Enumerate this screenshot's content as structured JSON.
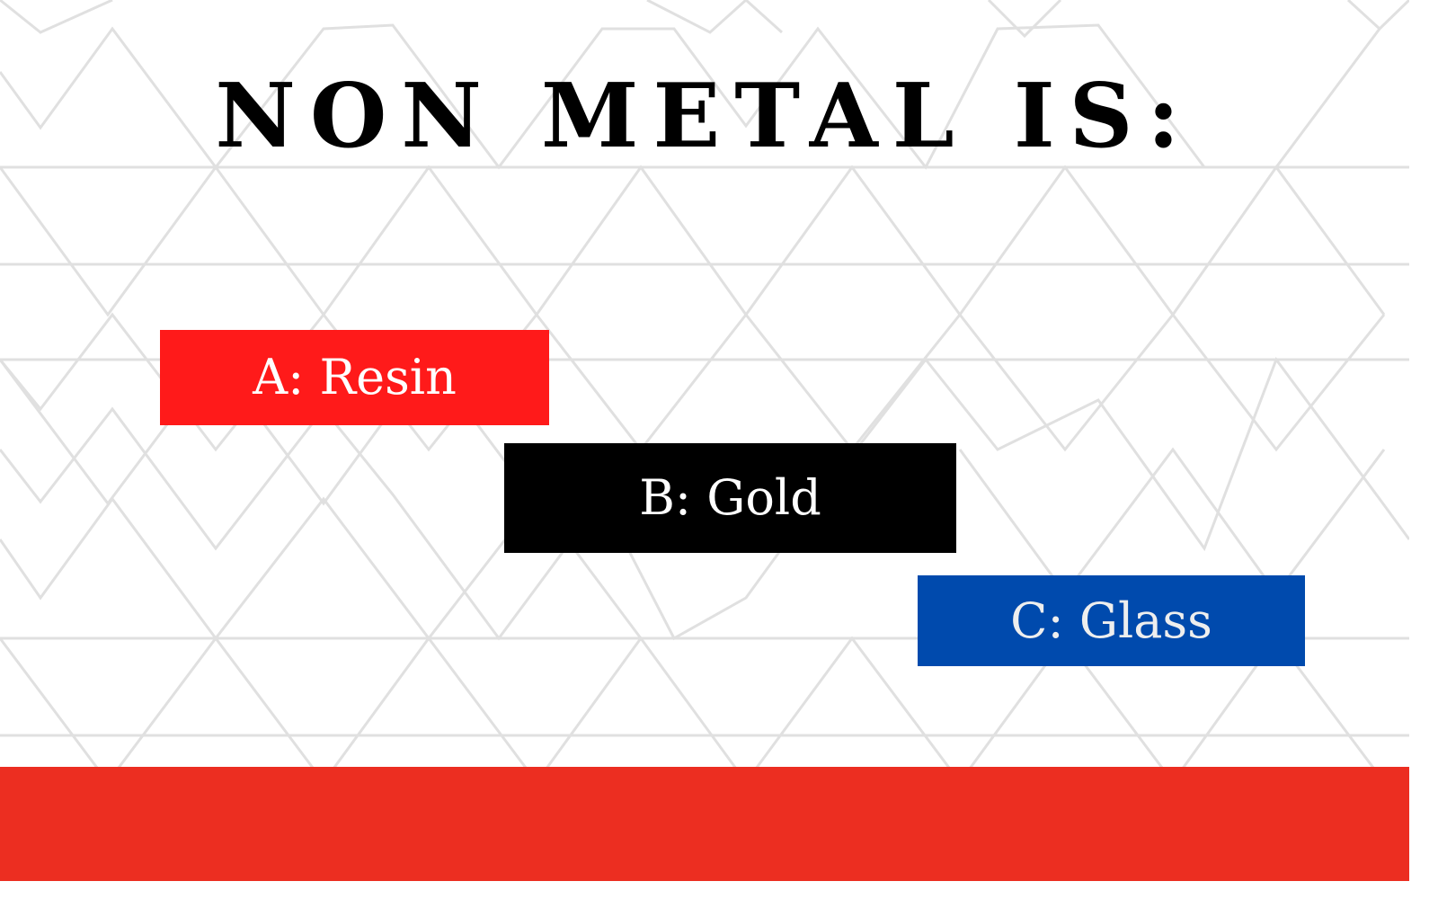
{
  "question": {
    "title": "NON METAL IS:"
  },
  "options": [
    {
      "label": "A: Resin",
      "background": "#ff1a1a",
      "text_color": "#ffffff"
    },
    {
      "label": "B: Gold",
      "background": "#000000",
      "text_color": "#ffffff"
    },
    {
      "label": "C: Glass",
      "background": "#004aad",
      "text_color": "#eeeeee"
    }
  ],
  "colors": {
    "background": "#ffffff",
    "pattern_line": "#e0e0e0",
    "title_text": "#000000",
    "footer_bar": "#ec2e21"
  }
}
